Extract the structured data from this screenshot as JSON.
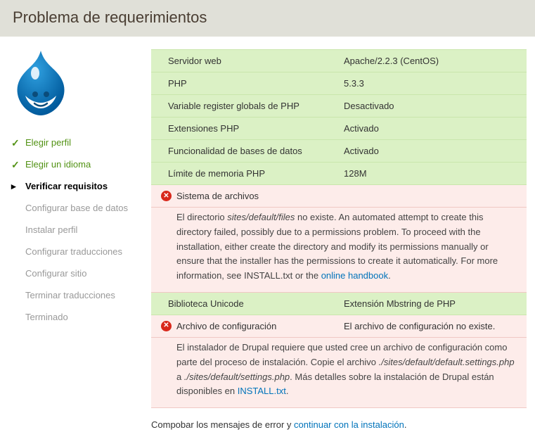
{
  "header": {
    "title": "Problema de requerimientos"
  },
  "steps": [
    {
      "label": "Elegir perfil",
      "state": "done"
    },
    {
      "label": "Elegir un idioma",
      "state": "done"
    },
    {
      "label": "Verificar requisitos",
      "state": "active"
    },
    {
      "label": "Configurar base de datos",
      "state": ""
    },
    {
      "label": "Instalar perfil",
      "state": ""
    },
    {
      "label": "Configurar traducciones",
      "state": ""
    },
    {
      "label": "Configurar sitio",
      "state": ""
    },
    {
      "label": "Terminar traducciones",
      "state": ""
    },
    {
      "label": "Terminado",
      "state": ""
    }
  ],
  "rows": {
    "web": {
      "label": "Servidor web",
      "value": "Apache/2.2.3 (CentOS)"
    },
    "php": {
      "label": "PHP",
      "value": "5.3.3"
    },
    "reg": {
      "label": "Variable register globals de PHP",
      "value": "Desactivado"
    },
    "ext": {
      "label": "Extensiones PHP",
      "value": "Activado"
    },
    "db": {
      "label": "Funcionalidad de bases de datos",
      "value": "Activado"
    },
    "mem": {
      "label": "Límite de memoria PHP",
      "value": "128M"
    },
    "uni": {
      "label": "Biblioteca Unicode",
      "value": "Extensión Mbstring de PHP"
    }
  },
  "err1": {
    "label": "Sistema de archivos",
    "t1": "El directorio ",
    "path": "sites/default/files",
    "t2": " no existe. An automated attempt to create this directory failed, possibly due to a permissions problem. To proceed with the installation, either create the directory and modify its permissions manually or ensure that the installer has the permissions to create it automatically. For more information, see INSTALL.txt or the ",
    "link": "online handbook",
    "t3": "."
  },
  "err2": {
    "label": "Archivo de configuración",
    "value": "El archivo de configuración no existe.",
    "t1": "El instalador de Drupal requiere que usted cree un archivo de configuración como parte del proceso de instalación. Copie el archivo ",
    "p1": "./sites/default/default.settings.php",
    "t2": " a ",
    "p2": "./sites/default/settings.php",
    "t3": ". Más detalles sobre la instalación de Drupal están disponibles en ",
    "link": "INSTALL.txt",
    "t4": "."
  },
  "footer": {
    "t1": "Compobar los mensajes de error y ",
    "link": "continuar con la instalación",
    "t2": "."
  }
}
